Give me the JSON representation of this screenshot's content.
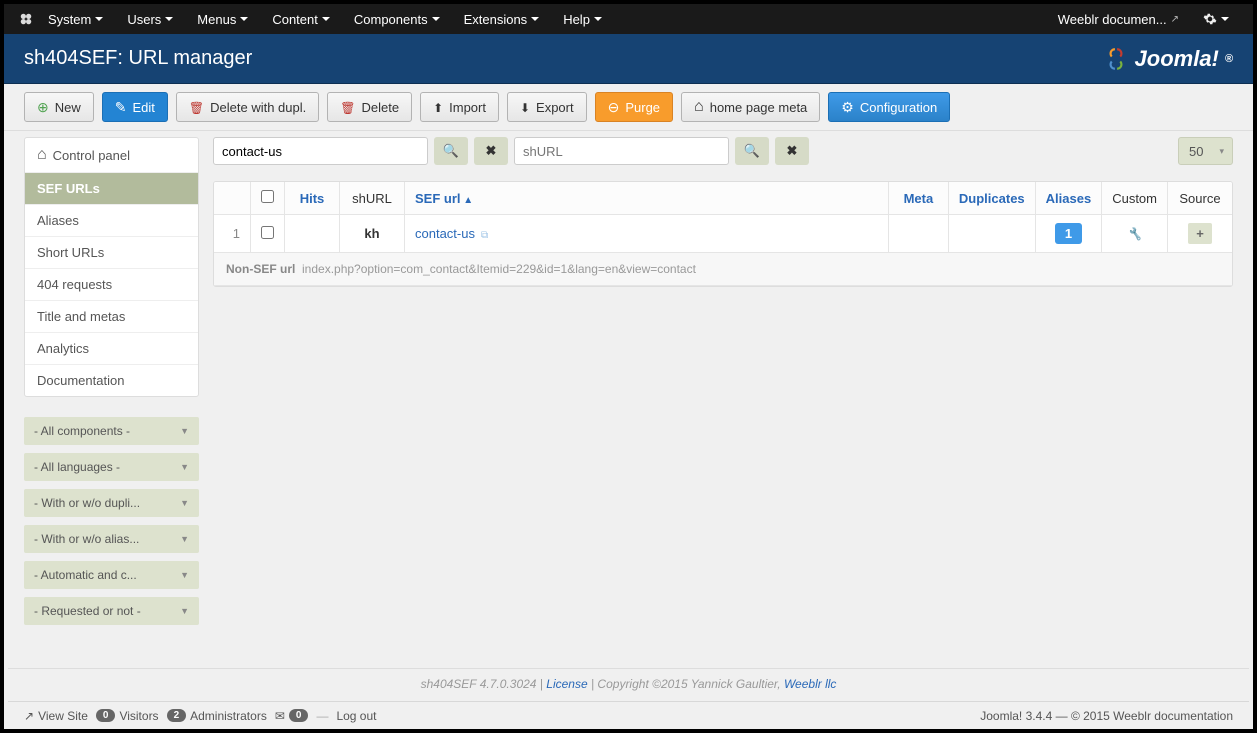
{
  "topmenu": {
    "items": [
      "System",
      "Users",
      "Menus",
      "Content",
      "Components",
      "Extensions",
      "Help"
    ],
    "right_label": "Weeblr documen..."
  },
  "header": {
    "title": "sh404SEF: URL manager",
    "brand": "Joomla!"
  },
  "toolbar": {
    "new": "New",
    "edit": "Edit",
    "delete_dupl": "Delete with dupl.",
    "delete": "Delete",
    "import": "Import",
    "export": "Export",
    "purge": "Purge",
    "home_meta": "home page meta",
    "configuration": "Configuration"
  },
  "sidebar": {
    "control_panel": "Control panel",
    "items": [
      {
        "label": "SEF URLs",
        "active": true
      },
      {
        "label": "Aliases"
      },
      {
        "label": "Short URLs"
      },
      {
        "label": "404 requests"
      },
      {
        "label": "Title and metas"
      },
      {
        "label": "Analytics"
      },
      {
        "label": "Documentation"
      }
    ],
    "filters": [
      "- All components -",
      "- All languages -",
      "- With or w/o dupli...",
      "- With or w/o alias...",
      "- Automatic and c...",
      "- Requested or not -"
    ]
  },
  "filters": {
    "search_value": "contact-us",
    "search2_placeholder": "shURL",
    "limit": "50"
  },
  "table": {
    "headers": {
      "hits": "Hits",
      "shurl": "shURL",
      "sef_url": "SEF url",
      "meta": "Meta",
      "duplicates": "Duplicates",
      "aliases": "Aliases",
      "custom": "Custom",
      "source": "Source"
    },
    "rows": [
      {
        "num": "1",
        "shurl": "kh",
        "sef_url": "contact-us",
        "aliases": "1",
        "source_plus": "+"
      }
    ],
    "nonsef": {
      "label": "Non-SEF url",
      "value": "index.php?option=com_contact&Itemid=229&id=1&lang=en&view=contact"
    }
  },
  "version_bar": {
    "product": "sh404SEF 4.7.0.3024",
    "license": "License",
    "sep1": " | ",
    "copyright": " | Copyright ©2015 Yannick Gaultier, ",
    "company": "Weeblr llc"
  },
  "statusbar": {
    "view_site": "View Site",
    "visitors_count": "0",
    "visitors": "Visitors",
    "admins_count": "2",
    "admins": "Administrators",
    "mail_count": "0",
    "logout": "Log out",
    "right": "Joomla! 3.4.4  —  © 2015 Weeblr documentation"
  }
}
